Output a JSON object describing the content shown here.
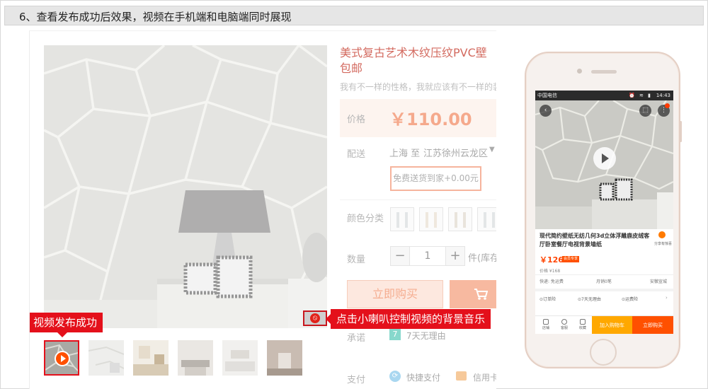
{
  "step": {
    "text": "6、查看发布成功后效果，视频在手机端和电脑端同时展现"
  },
  "annotations": {
    "video_published": "视频发布成功",
    "mute_tip": "点击小喇叭控制视频的背景音乐"
  },
  "product": {
    "title_line1": "美式复古艺术木纹压纹PVC壁",
    "title_line2": "包邮",
    "subtitle": "我有不一样的性格，我就应该有不一样的装",
    "price_label": "价格",
    "price": "￥110.00",
    "shipping_label": "配送",
    "ship_from": "上海 至",
    "ship_to": "江苏徐州云龙区",
    "free_shipping": "免费送货到家+0.00元",
    "color_label": "颜色分类",
    "qty_label": "数量",
    "qty_minus": "−",
    "qty_value": "1",
    "qty_plus": "+",
    "stock_text": "件(库存",
    "buy_now": "立即购买",
    "promise_label": "承诺",
    "promise_icon": "7",
    "promise_text": "7天无理由",
    "payment_label": "支付",
    "pay_option_1": "快捷支付",
    "pay_option_2": "信用卡"
  },
  "mobile": {
    "carrier": "中国电信",
    "status_icons": "⏰ ≋ ▮",
    "time": "14:43",
    "back_glyph": "‹",
    "more_glyph": "⋮",
    "title": "现代简约壁纸无纺几何3d立体浮雕鹿皮绒客厅卧室餐厅电视背景墙纸",
    "share": "分享有惊喜",
    "price": "￥126",
    "price_tag": "会员专享",
    "orig_price": "价格 ¥168",
    "ship_fee": "快递: 免运费",
    "monthly_sales": "月销0笔",
    "location": "安徽宣城",
    "svc_1": "⊙订单险",
    "svc_2": "⊙7天无理由",
    "svc_3": "⊙运费险",
    "svc_caret": "›",
    "tab_shop": "店铺",
    "tab_service": "客服",
    "tab_fav": "收藏",
    "add_cart": "加入购物车",
    "buy_now": "立即购买"
  },
  "colors": {
    "accent_red": "#e4101b",
    "taobao_orange": "#ff5000",
    "cart_yellow": "#ffa800"
  }
}
